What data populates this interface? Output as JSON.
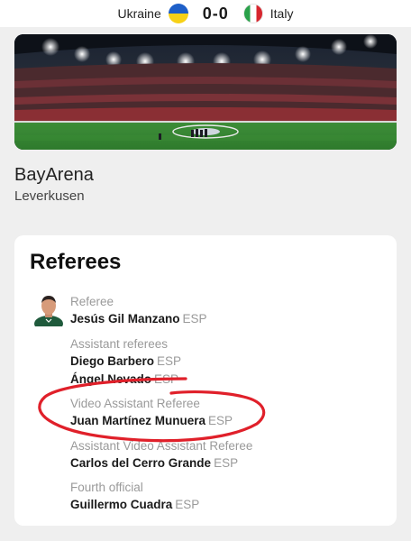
{
  "match": {
    "home_team": "Ukraine",
    "away_team": "Italy",
    "score": "0-0"
  },
  "venue": {
    "name": "BayArena",
    "city": "Leverkusen"
  },
  "referees_section": {
    "title": "Referees",
    "entries": [
      {
        "role": "Referee",
        "names": [
          {
            "name": "Jesús Gil Manzano",
            "nationality": "ESP"
          }
        ]
      },
      {
        "role": "Assistant referees",
        "names": [
          {
            "name": "Diego Barbero",
            "nationality": "ESP"
          },
          {
            "name": "Ángel Nevado",
            "nationality": "ESP"
          }
        ]
      },
      {
        "role": "Video Assistant Referee",
        "names": [
          {
            "name": "Juan Martínez Munuera",
            "nationality": "ESP"
          }
        ]
      },
      {
        "role": "Assistant Video Assistant Referee",
        "names": [
          {
            "name": "Carlos del Cerro Grande",
            "nationality": "ESP"
          }
        ]
      },
      {
        "role": "Fourth official",
        "names": [
          {
            "name": "Guillermo Cuadra",
            "nationality": "ESP"
          }
        ]
      }
    ]
  },
  "annotation": {
    "color": "#e0202a"
  }
}
